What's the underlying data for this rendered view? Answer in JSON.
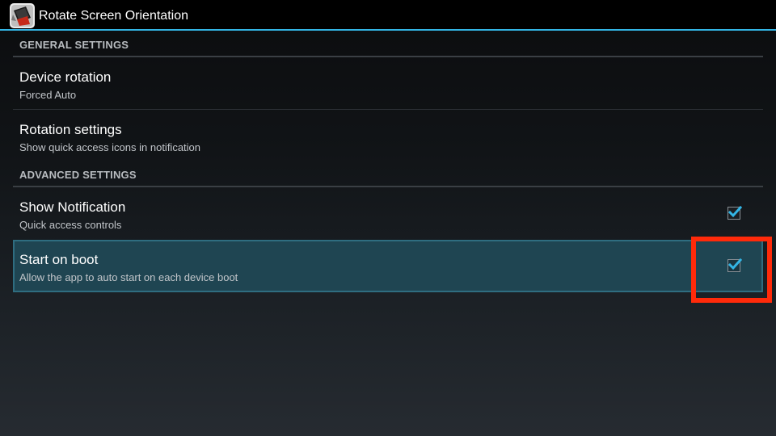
{
  "app": {
    "title": "Rotate Screen Orientation",
    "icon": "rotate-app-icon"
  },
  "colors": {
    "accent": "#33b5e5",
    "selected_row": "#1f4552",
    "highlight": "#ff2a0a"
  },
  "sections": [
    {
      "header": "GENERAL SETTINGS",
      "items": [
        {
          "title": "Device rotation",
          "summary": "Forced Auto"
        },
        {
          "title": "Rotation settings",
          "summary": "Show quick access icons in notification"
        }
      ]
    },
    {
      "header": "ADVANCED SETTINGS",
      "items": [
        {
          "title": "Show Notification",
          "summary": "Quick access controls",
          "checked": true
        },
        {
          "title": "Start on boot",
          "summary": "Allow the app to auto start on each device boot",
          "checked": true,
          "selected": true
        }
      ]
    }
  ]
}
